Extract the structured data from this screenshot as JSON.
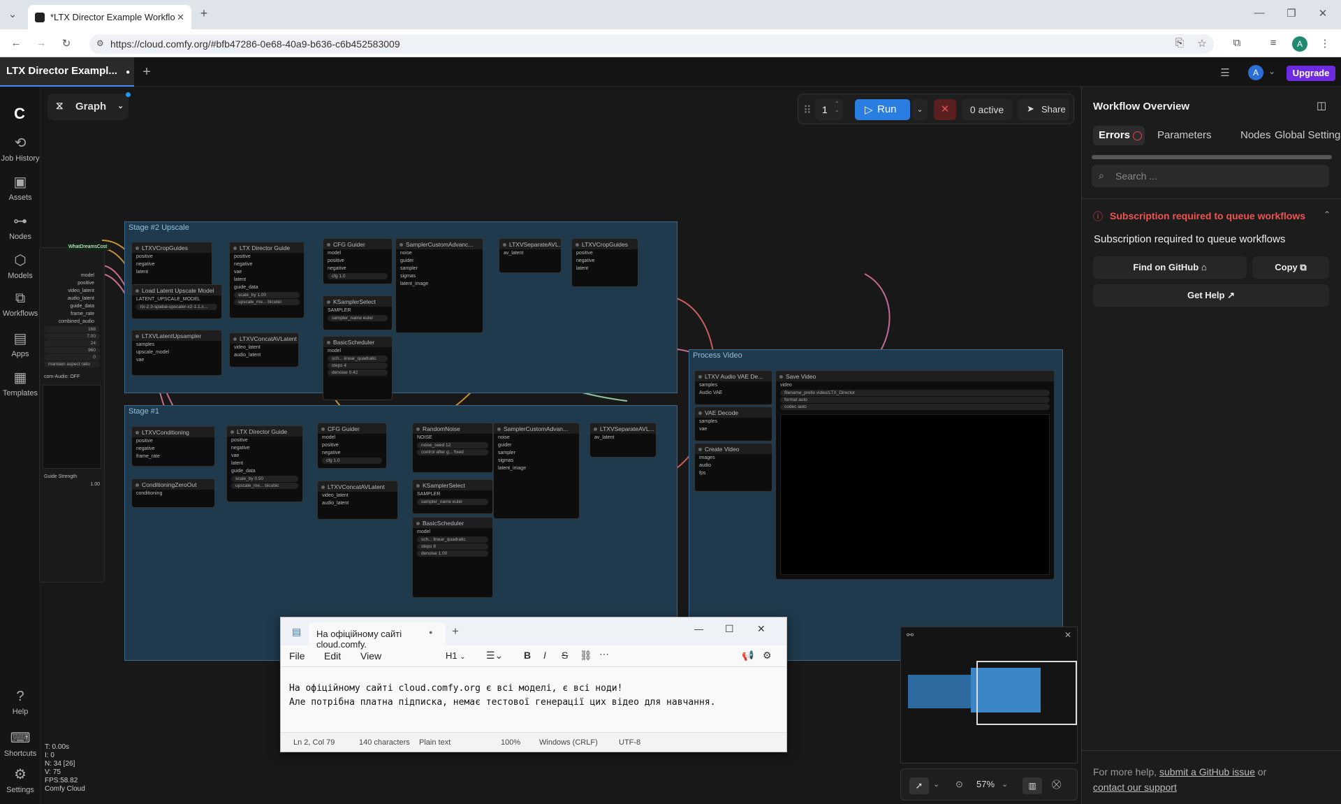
{
  "browser": {
    "tab_title": "*LTX Director Example Workflo",
    "url": "https://cloud.comfy.org/#bfb47286-0e68-40a9-b636-c6b452583009"
  },
  "app": {
    "tab_title": "LTX Director Exampl...",
    "upgrade": "Upgrade",
    "avatar": "A",
    "graph_label": "Graph",
    "run_count": "1",
    "run_label": "Run",
    "active": "0 active",
    "share": "Share"
  },
  "sidebar": {
    "items": [
      {
        "label": "Job History"
      },
      {
        "label": "Assets"
      },
      {
        "label": "Nodes"
      },
      {
        "label": "Models"
      },
      {
        "label": "Workflows"
      },
      {
        "label": "Apps"
      },
      {
        "label": "Templates"
      },
      {
        "label": "Help"
      },
      {
        "label": "Shortcuts"
      },
      {
        "label": "Settings"
      }
    ]
  },
  "stats": {
    "t": "T: 0.00s",
    "i": "I: 0",
    "n": "N: 34 [26]",
    "v": "V: 75",
    "fps": "FPS:58.82",
    "cloud": "Comfy Cloud"
  },
  "panel": {
    "title": "Workflow Overview",
    "tabs": [
      "Errors",
      "Parameters",
      "Nodes",
      "Global Settings"
    ],
    "search_placeholder": "Search ...",
    "error_title": "Subscription required to queue workflows",
    "error_message": "Subscription required to queue workflows",
    "find_github": "Find on GitHub",
    "copy": "Copy",
    "get_help": "Get Help",
    "footer_text": "For more help,",
    "footer_link1": "submit a GitHub issue",
    "footer_or": "or",
    "footer_link2": "contact our support"
  },
  "graph": {
    "groups": [
      {
        "title": "Stage #2 Upscale"
      },
      {
        "title": "Stage #1"
      },
      {
        "title": "Process Video"
      }
    ],
    "nodes": [
      {
        "title": "LTXVCropGuides",
        "rows": [
          "positive",
          "negative",
          "latent"
        ]
      },
      {
        "title": "LTX Director Guide",
        "rows": [
          "positive",
          "negative",
          "vae",
          "latent",
          "guide_data"
        ],
        "widgets": [
          "scale_by 1.00",
          "upscale_me... bicubic"
        ]
      },
      {
        "title": "CFG Guider",
        "rows": [
          "model",
          "positive",
          "negative"
        ],
        "widgets": [
          "cfg 1.0"
        ]
      },
      {
        "title": "SamplerCustomAdvanc...",
        "rows": [
          "noise",
          "guider",
          "sampler",
          "sigmas",
          "latent_image"
        ]
      },
      {
        "title": "LTXVSeparateAVL...",
        "rows": [
          "av_latent"
        ]
      },
      {
        "title": "LTXVCropGuides",
        "rows": [
          "positive",
          "negative",
          "latent"
        ]
      },
      {
        "title": "Load Latent Upscale Model",
        "rows": [
          "LATENT_UPSCALE_MODEL"
        ],
        "widgets": [
          "ltx-2.3-spatial-upscaler-x2-1.1.s..."
        ]
      },
      {
        "title": "KSamplerSelect",
        "rows": [
          "SAMPLER"
        ],
        "widgets": [
          "sampler_name euler"
        ]
      },
      {
        "title": "LTXVLatentUpsampler",
        "rows": [
          "samples",
          "upscale_model",
          "vae"
        ]
      },
      {
        "title": "LTXVConcatAVLatent",
        "rows": [
          "video_latent",
          "audio_latent"
        ]
      },
      {
        "title": "BasicScheduler",
        "rows": [
          "model"
        ],
        "widgets": [
          "sch... linear_quadratic",
          "steps 4",
          "denoise 0.42"
        ]
      },
      {
        "title": "LTXV Audio VAE De...",
        "rows": [
          "samples",
          "Audio VAE"
        ]
      },
      {
        "title": "Save Video",
        "rows": [
          "video"
        ],
        "widgets": [
          "filename_prefix video/LTX_Director",
          "format auto",
          "codec auto"
        ]
      },
      {
        "title": "VAE Decode",
        "rows": [
          "samples",
          "vae"
        ]
      },
      {
        "title": "Create Video",
        "rows": [
          "images",
          "audio",
          "fps"
        ]
      },
      {
        "title": "LTXVConditioning",
        "rows": [
          "positive",
          "negative",
          "frame_rate"
        ]
      },
      {
        "title": "LTX Director Guide",
        "rows": [
          "positive",
          "negative",
          "vae",
          "latent",
          "guide_data"
        ],
        "widgets": [
          "scale_by 0.50",
          "upscale_me... bicubic"
        ]
      },
      {
        "title": "CFG Guider",
        "rows": [
          "model",
          "positive",
          "negative"
        ],
        "widgets": [
          "cfg 1.0"
        ]
      },
      {
        "title": "RandomNoise",
        "rows": [
          "NOISE"
        ],
        "widgets": [
          "noise_seed 12",
          "control after g... fixed"
        ]
      },
      {
        "title": "SamplerCustomAdvan...",
        "rows": [
          "noise",
          "guider",
          "sampler",
          "sigmas",
          "latent_image"
        ]
      },
      {
        "title": "LTXVSeparateAVL...",
        "rows": [
          "av_latent"
        ]
      },
      {
        "title": "ConditioningZeroOut",
        "rows": [
          "conditioning"
        ]
      },
      {
        "title": "LTXVConcatAVLatent",
        "rows": [
          "video_latent",
          "audio_latent"
        ]
      },
      {
        "title": "KSamplerSelect",
        "rows": [
          "SAMPLER"
        ],
        "widgets": [
          "sampler_name euler"
        ]
      },
      {
        "title": "BasicScheduler",
        "rows": [
          "model"
        ],
        "widgets": [
          "sch... linear_quadratic",
          "steps 8",
          "denoise 1.00"
        ]
      }
    ],
    "side_widget": {
      "badge": "WhatDreamsCost",
      "outputs": [
        "model",
        "positive",
        "video_latent",
        "audio_latent",
        "guide_data",
        "frame_rate",
        "combined_audio"
      ],
      "values": [
        "168",
        "7.00",
        "24",
        "960",
        "0",
        "maintain aspect ratio"
      ],
      "audio": "com-Audio: OFF",
      "guide_strength": "Guide Strength",
      "guide_val": "1.00"
    }
  },
  "notepad": {
    "tab_title": "На офіційному сайті cloud.comfy.",
    "menu": [
      "File",
      "Edit",
      "View"
    ],
    "heading": "H1",
    "line1": "На офіційному сайті cloud.comfy.org є всі моделі, є всі ноди!",
    "line2": "Але потрібна платна підписка, немає тестової генерації цих відео для навчання.",
    "status": [
      "Ln 2, Col 79",
      "140 characters",
      "Plain text",
      "100%",
      "Windows (CRLF)",
      "UTF-8"
    ]
  },
  "minimap": {
    "zoom": "57%"
  }
}
